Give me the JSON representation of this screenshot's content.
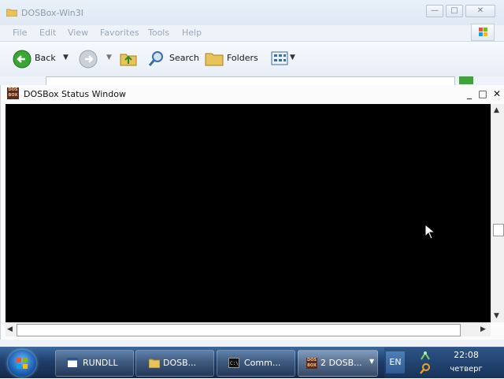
{
  "explorer": {
    "title": "DOSBox-Win3I",
    "menu": [
      "File",
      "Edit",
      "View",
      "Favorites",
      "Tools",
      "Help"
    ],
    "toolbar": {
      "back_label": "Back",
      "search_label": "Search",
      "folders_label": "Folders"
    }
  },
  "dosbox": {
    "title": "DOSBox Status Window",
    "icon_text": "DOS BOX"
  },
  "taskbar": {
    "items": [
      {
        "label": "RUNDLL"
      },
      {
        "label": "DOSB..."
      },
      {
        "label": "Comm..."
      },
      {
        "label": "2 DOSB..."
      }
    ],
    "language": "EN",
    "time": "22:08",
    "day": "четверг"
  },
  "colors": {
    "taskbar": "#1f3f6b",
    "screen": "#000000",
    "window_frame": "#eef3fa"
  }
}
